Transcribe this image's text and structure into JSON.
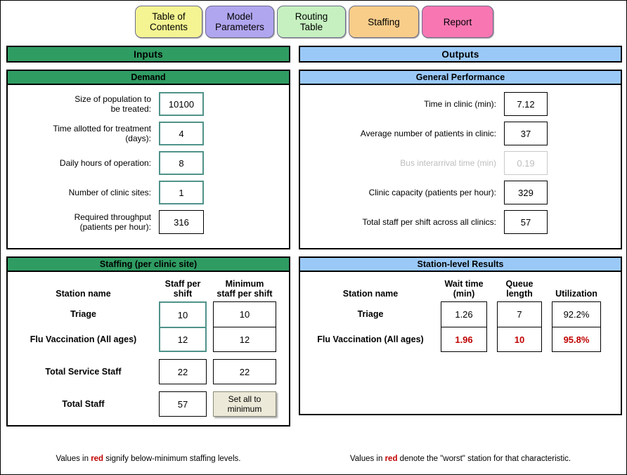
{
  "tabs": [
    {
      "label": "Table of Contents",
      "line1": "Table of",
      "line2": "Contents",
      "color": "#f4f493"
    },
    {
      "label": "Model Parameters",
      "line1": "Model",
      "line2": "Parameters",
      "color": "#b0a6ef"
    },
    {
      "label": "Routing Table",
      "line1": "Routing",
      "line2": "Table",
      "color": "#c6f0c0"
    },
    {
      "label": "Staffing",
      "line1": "Staffing",
      "line2": "",
      "color": "#f8cd8a"
    },
    {
      "label": "Report",
      "line1": "Report",
      "line2": "",
      "color": "#f877b2"
    }
  ],
  "inputs": {
    "title": "Inputs",
    "accent": "#2f9c62",
    "demand": {
      "title": "Demand",
      "fields": [
        {
          "label_line1": "Size of population to",
          "label_line2": "be treated:",
          "value": "10100",
          "editable": true
        },
        {
          "label_line1": "Time allotted for treatment",
          "label_line2": "(days):",
          "value": "4",
          "editable": true
        },
        {
          "label_line1": "Daily hours of operation:",
          "label_line2": "",
          "value": "8",
          "editable": true
        },
        {
          "label_line1": "Number of clinic sites:",
          "label_line2": "",
          "value": "1",
          "editable": true
        },
        {
          "label_line1": "Required throughput",
          "label_line2": "(patients per hour):",
          "value": "316",
          "editable": false
        }
      ]
    },
    "staffing": {
      "title": "Staffing (per clinic site)",
      "headers": {
        "name": "Station name",
        "c1_line1": "Staff per",
        "c1_line2": "shift",
        "c2_line1": "Minimum",
        "c2_line2": "staff per shift"
      },
      "stations": [
        {
          "name": "Triage",
          "staff_per_shift": "10",
          "minimum_staff_per_shift": "10"
        },
        {
          "name": "Flu Vaccination (All ages)",
          "staff_per_shift": "12",
          "minimum_staff_per_shift": "12"
        }
      ],
      "total_service_staff": {
        "name": "Total Service Staff",
        "staff_per_shift": "22",
        "minimum_staff_per_shift": "22"
      },
      "total_staff": {
        "name": "Total Staff",
        "staff_per_shift": "57"
      },
      "set_min_button": {
        "line1": "Set all to",
        "line2": "minimum"
      }
    },
    "footnote_prefix": "Values in ",
    "footnote_red": "red",
    "footnote_suffix": " signify below-minimum staffing levels."
  },
  "outputs": {
    "title": "Outputs",
    "accent": "#9ac9f8",
    "general_performance": {
      "title": "General Performance",
      "fields": [
        {
          "label": "Time in clinic (min):",
          "value": "7.12",
          "disabled": false
        },
        {
          "label": "Average number of patients in clinic:",
          "value": "37",
          "disabled": false
        },
        {
          "label": "Bus interarrival time (min)",
          "value": "0.19",
          "disabled": true
        },
        {
          "label": "Clinic capacity (patients per hour):",
          "value": "329",
          "disabled": false
        },
        {
          "label": "Total staff per shift across all clinics:",
          "value": "57",
          "disabled": false
        }
      ]
    },
    "station_results": {
      "title": "Station-level Results",
      "headers": {
        "name": "Station name",
        "c1_line1": "Wait time",
        "c1_line2": "(min)",
        "c2_line1": "Queue",
        "c2_line2": "length",
        "c3_line1": "Utilization",
        "c3_line2": ""
      },
      "rows": [
        {
          "name": "Triage",
          "wait_time": "1.26",
          "queue_length": "7",
          "utilization": "92.2%",
          "worst": false
        },
        {
          "name": "Flu Vaccination (All ages)",
          "wait_time": "1.96",
          "queue_length": "10",
          "utilization": "95.8%",
          "worst": true
        }
      ]
    },
    "footnote_prefix": "Values in ",
    "footnote_red": "red",
    "footnote_suffix": " denote the \"worst\" station for that characteristic."
  }
}
